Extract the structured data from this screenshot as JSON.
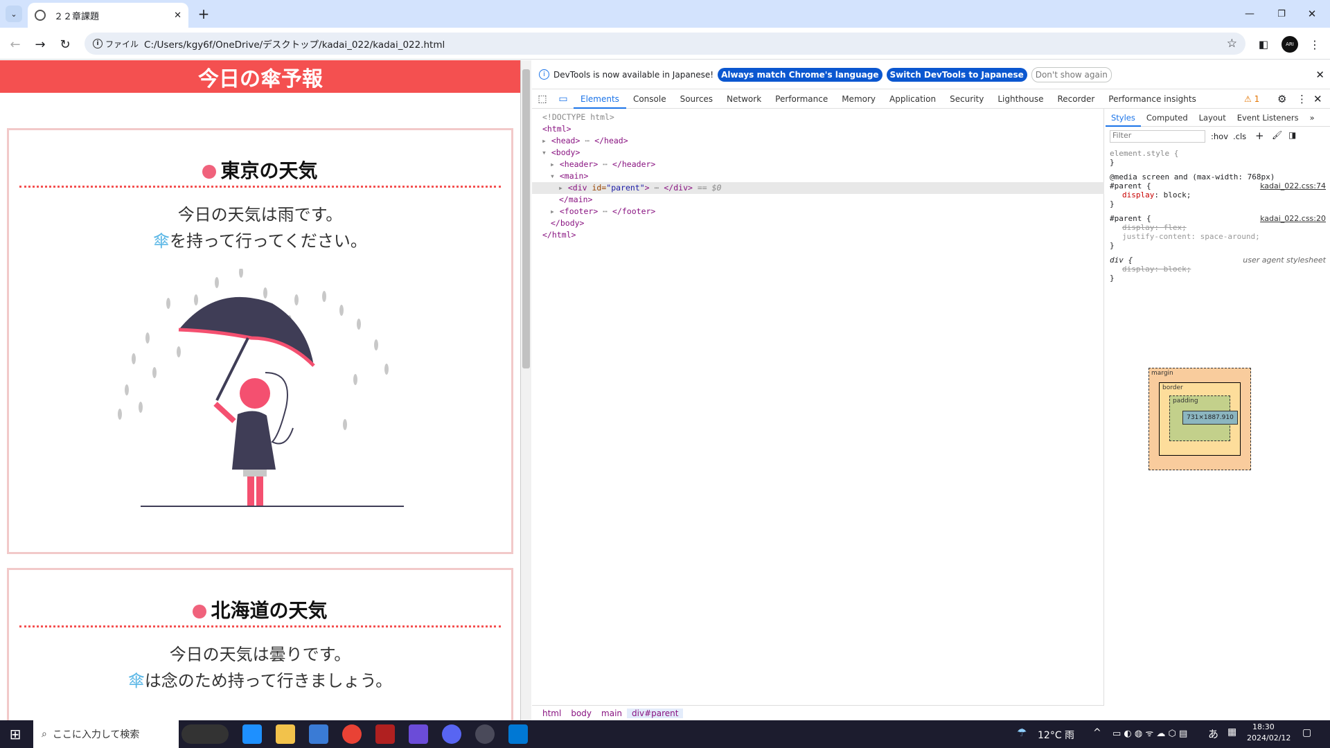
{
  "browser": {
    "tab_title": "２２章課題",
    "new_tab": "+",
    "address_chip": "ファイル",
    "url": "C:/Users/kgy6f/OneDrive/デスクトップ/kadai_022/kadai_022.html",
    "profile": "ARI"
  },
  "page": {
    "header_title": "今日の傘予報",
    "cards": [
      {
        "title": "東京の天気",
        "line1": "今日の天気は雨です。",
        "line2_umbrella": "傘",
        "line2_rest": "を持って行ってください。"
      },
      {
        "title": "北海道の天気",
        "line1": "今日の天気は曇りです。",
        "line2_umbrella": "傘",
        "line2_rest": "は念のため持って行きましょう。"
      }
    ]
  },
  "devtools": {
    "info_text": "DevTools is now available in Japanese!",
    "btn_match": "Always match Chrome's language",
    "btn_switch": "Switch DevTools to Japanese",
    "btn_dont": "Don't show again",
    "tabs": [
      "Elements",
      "Console",
      "Sources",
      "Network",
      "Performance",
      "Memory",
      "Application",
      "Security",
      "Lighthouse",
      "Recorder",
      "Performance insights"
    ],
    "warning_count": "1",
    "dom": {
      "doctype": "<!DOCTYPE html>",
      "html_open": "<html>",
      "head": "<head>",
      "head_close": "</head>",
      "body": "<body>",
      "header": "<header>",
      "header_close": "</header>",
      "main": "<main>",
      "div_open": "<div ",
      "div_attr": "id=",
      "div_val": "\"parent\"",
      "div_close": "</div>",
      "div_eq": "== $0",
      "main_close": "</main>",
      "footer": "<footer>",
      "footer_close": "</footer>",
      "body_close": "</body>",
      "html_close": "</html>"
    },
    "crumbs": [
      "html",
      "body",
      "main",
      "div#parent"
    ],
    "styles": {
      "tabs": [
        "Styles",
        "Computed",
        "Layout",
        "Event Listeners"
      ],
      "filter_placeholder": "Filter",
      "hov": ":hov",
      "cls": ".cls",
      "element_style": "element.style {",
      "close_brace": "}",
      "media": "@media screen and (max-width: 768px)",
      "rule1_sel": "#parent {",
      "rule1_src": "kadai_022.css:74",
      "rule1_prop": "display",
      "rule1_val": "block;",
      "rule2_sel": "#parent {",
      "rule2_src": "kadai_022.css:20",
      "rule2_prop1": "display: flex;",
      "rule2_prop2": "justify-content",
      "rule2_val2": "space-around;",
      "rule3_sel": "div {",
      "rule3_src": "user agent stylesheet",
      "rule3_prop": "display: block;",
      "bm_margin": "margin",
      "bm_border": "border",
      "bm_padding": "padding",
      "bm_dash": "–",
      "bm_size": "731×1887.910"
    }
  },
  "taskbar": {
    "search_placeholder": "ここに入力して検索",
    "weather": "12°C 雨",
    "time": "18:30",
    "date": "2024/02/12",
    "ime": "あ"
  }
}
